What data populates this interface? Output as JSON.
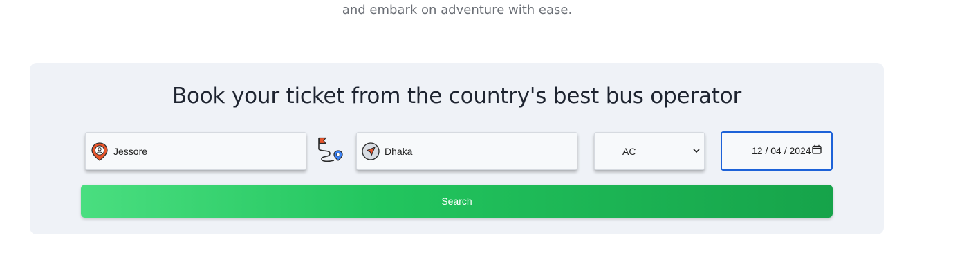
{
  "hero": {
    "tagline": "and embark on adventure with ease."
  },
  "booking": {
    "title": "Book your ticket from the country's best bus operator",
    "from": {
      "value": "Jessore",
      "icon": "location-pin-icon"
    },
    "swap_icon": "route-icon",
    "to": {
      "value": "Dhaka",
      "icon": "navigation-icon"
    },
    "bus_class": {
      "selected": "AC"
    },
    "date": {
      "value": "12 / 04 / 2024"
    },
    "search_label": "Search"
  },
  "colors": {
    "panel_bg": "#eff2f7",
    "button_start": "#4ade80",
    "button_end": "#16a34a",
    "focus_border": "#1d62d8",
    "pin_orange": "#e8552b"
  }
}
